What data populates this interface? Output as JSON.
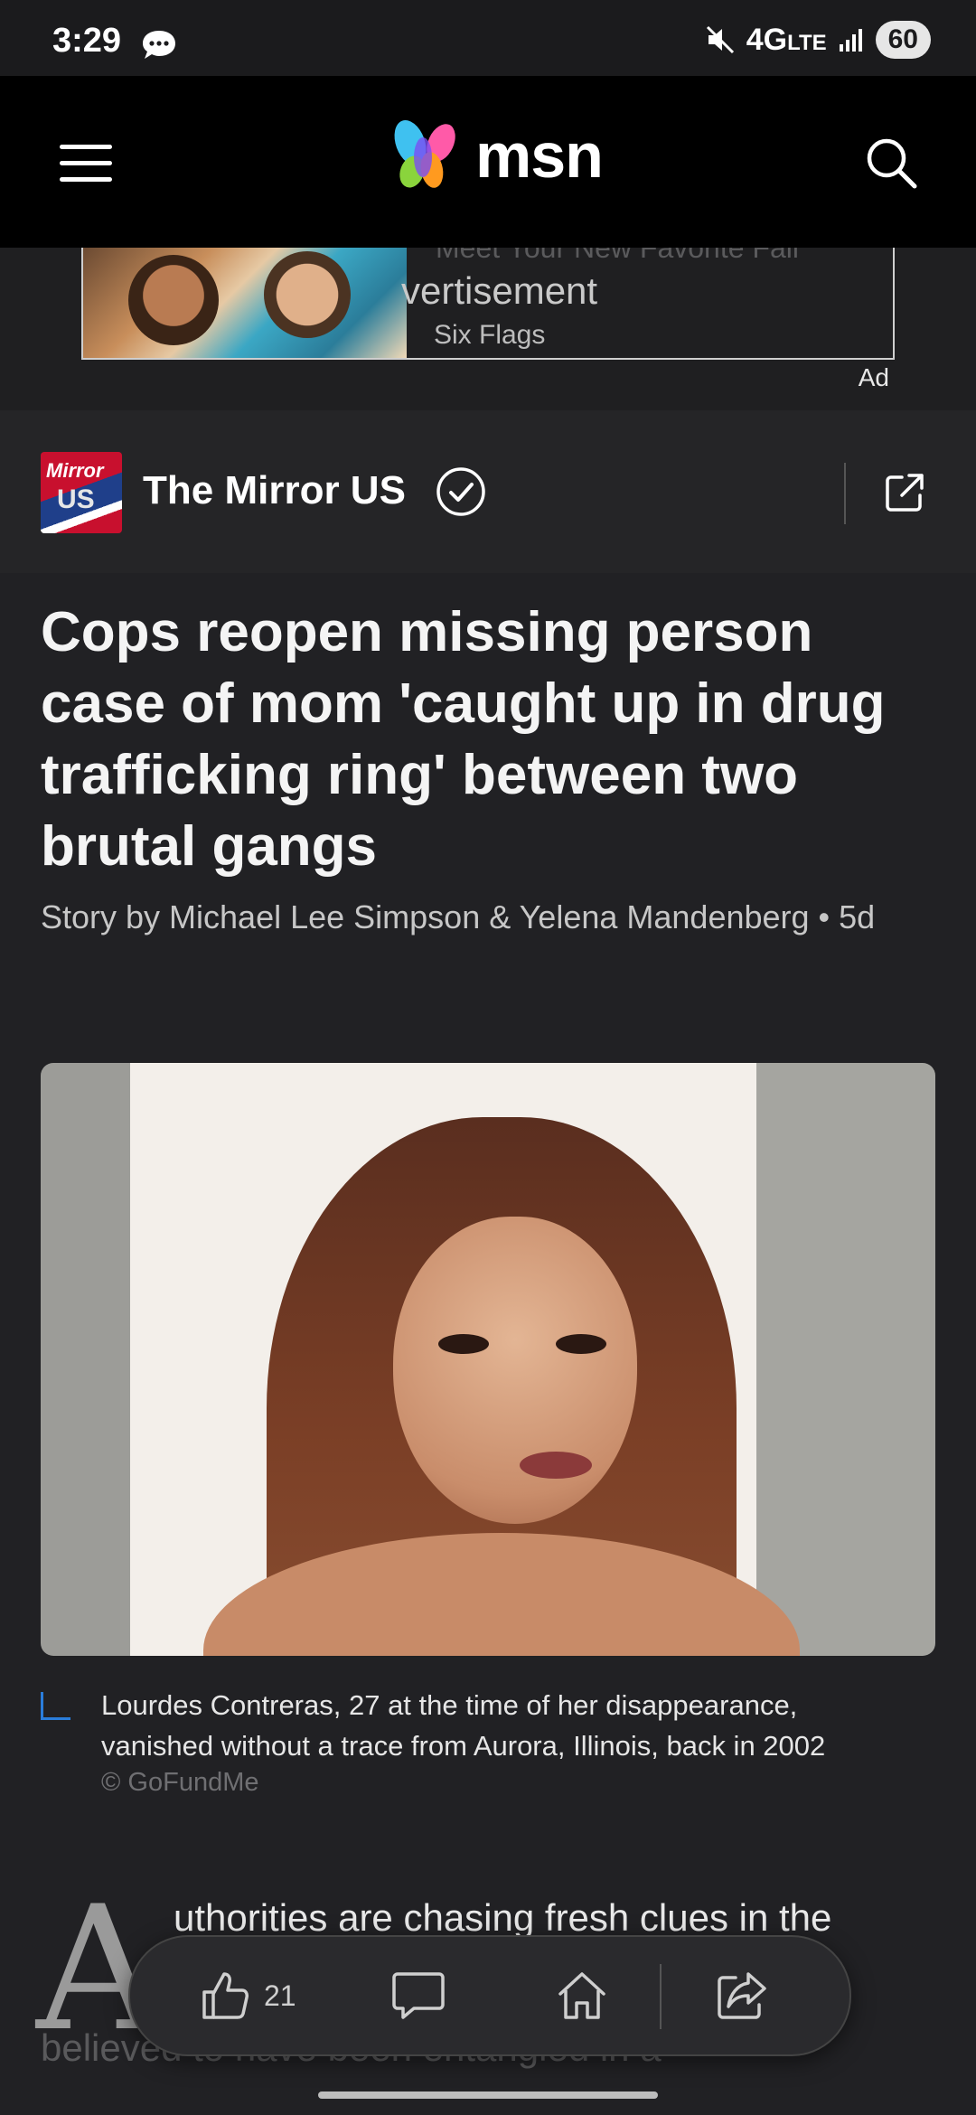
{
  "status_bar": {
    "time": "3:29",
    "network": "4G",
    "network_suffix": "LTE",
    "battery": "60"
  },
  "header": {
    "logo_text": "msn",
    "menu_icon": "hamburger-menu-icon",
    "search_icon": "search-icon"
  },
  "ad": {
    "headline": "Meet Your New Favorite Fall",
    "overlay_text": "vertisement",
    "sponsor": "Six Flags",
    "label": "Ad"
  },
  "publisher": {
    "logo_top": "Mirror",
    "logo_bottom": "US",
    "name": "The Mirror US"
  },
  "article": {
    "headline": "Cops reopen missing person case of mom 'caught up in drug trafficking ring' between two brutal gangs",
    "byline": "Story by Michael Lee Simpson & Yelena Mandenberg • 5d",
    "caption": "Lourdes Contreras, 27 at the time of her disappearance, vanished without a trace from Aurora, Illinois, back in 2002",
    "credit": "© GoFundMe",
    "dropcap": "A",
    "body_first_line": "uthorities are chasing fresh clues in the",
    "body_second_line": "believed to have been entangled in a"
  },
  "action_bar": {
    "like_count": "21"
  },
  "colors": {
    "background": "#212124",
    "header": "#000000",
    "caption_accent": "#2a7ddb"
  }
}
